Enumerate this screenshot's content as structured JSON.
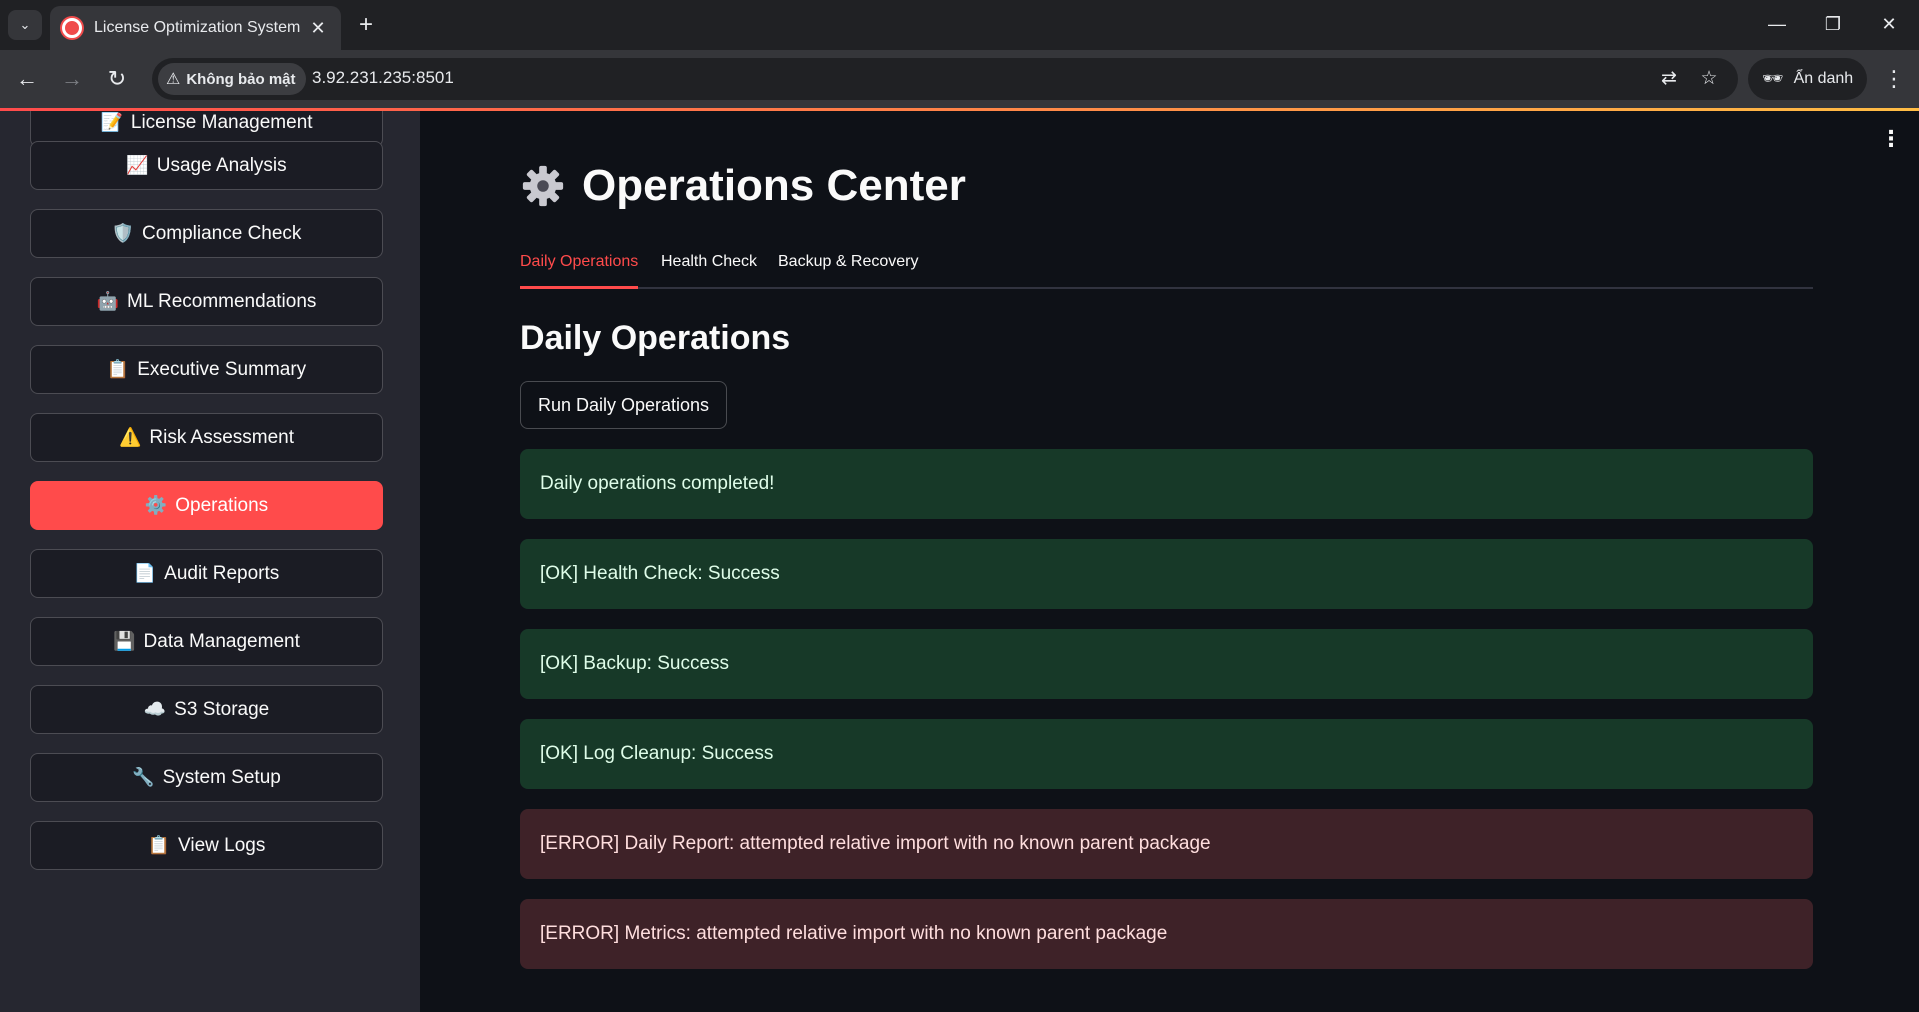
{
  "browser": {
    "tab_title": "License Optimization System",
    "tab_close": "✕",
    "new_tab": "+",
    "security_label": "Không bảo mật",
    "url": "3.92.231.235:8501",
    "incognito_label": "Ẩn danh"
  },
  "sidebar": {
    "items": [
      {
        "icon": "📝",
        "label": "License Management"
      },
      {
        "icon": "📈",
        "label": "Usage Analysis"
      },
      {
        "icon": "🛡️",
        "label": "Compliance Check"
      },
      {
        "icon": "🤖",
        "label": "ML Recommendations"
      },
      {
        "icon": "📋",
        "label": "Executive Summary"
      },
      {
        "icon": "⚠️",
        "label": "Risk Assessment"
      },
      {
        "icon": "⚙️",
        "label": "Operations",
        "active": true
      },
      {
        "icon": "📄",
        "label": "Audit Reports"
      },
      {
        "icon": "💾",
        "label": "Data Management"
      },
      {
        "icon": "☁️",
        "label": "S3 Storage"
      },
      {
        "icon": "🔧",
        "label": "System Setup"
      },
      {
        "icon": "📋",
        "label": "View Logs"
      }
    ]
  },
  "main": {
    "title": "Operations Center",
    "tabs": [
      {
        "label": "Daily Operations",
        "active": true
      },
      {
        "label": "Health Check"
      },
      {
        "label": "Backup & Recovery"
      }
    ],
    "section_title": "Daily Operations",
    "run_button_label": "Run Daily Operations",
    "messages": [
      {
        "type": "success",
        "text": "Daily operations completed!"
      },
      {
        "type": "success",
        "text": "[OK] Health Check: Success"
      },
      {
        "type": "success",
        "text": "[OK] Backup: Success"
      },
      {
        "type": "success",
        "text": "[OK] Log Cleanup: Success"
      },
      {
        "type": "error",
        "text": "[ERROR] Daily Report: attempted relative import with no known parent package"
      },
      {
        "type": "error",
        "text": "[ERROR] Metrics: attempted relative import with no known parent package"
      }
    ]
  },
  "colors": {
    "accent": "#ff4b4b",
    "success_bg": "#173928",
    "error_bg": "#3e2228"
  }
}
